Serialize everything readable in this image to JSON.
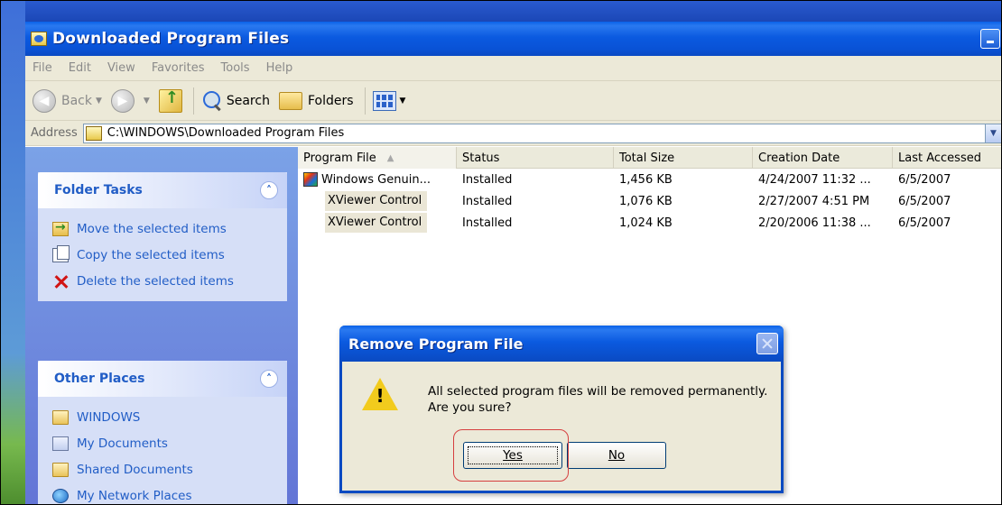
{
  "window": {
    "title": "Downloaded Program Files"
  },
  "menu": [
    "File",
    "Edit",
    "View",
    "Favorites",
    "Tools",
    "Help"
  ],
  "toolbar": {
    "back_label": "Back",
    "search_label": "Search",
    "folders_label": "Folders"
  },
  "address": {
    "label": "Address",
    "value": "C:\\WINDOWS\\Downloaded Program Files"
  },
  "folder_tasks": {
    "title": "Folder Tasks",
    "items": [
      {
        "label": "Move the selected items",
        "icon": "move-icon"
      },
      {
        "label": "Copy the selected items",
        "icon": "copy-icon"
      },
      {
        "label": "Delete the selected items",
        "icon": "delete-icon"
      }
    ]
  },
  "other_places": {
    "title": "Other Places",
    "items": [
      {
        "label": "WINDOWS",
        "icon": "folder-icon"
      },
      {
        "label": "My Documents",
        "icon": "docs-icon"
      },
      {
        "label": "Shared Documents",
        "icon": "folder-icon"
      },
      {
        "label": "My Network Places",
        "icon": "network-icon"
      }
    ]
  },
  "file_list": {
    "columns": [
      "Program File",
      "Status",
      "Total Size",
      "Creation Date",
      "Last Accessed"
    ],
    "rows": [
      {
        "name": "Windows Genuin...",
        "status": "Installed",
        "size": "1,456 KB",
        "created": "4/24/2007 11:32 ...",
        "accessed": "6/5/2007"
      },
      {
        "name": "XViewer Control",
        "status": "Installed",
        "size": "1,076 KB",
        "created": "2/27/2007 4:51 PM",
        "accessed": "6/5/2007"
      },
      {
        "name": "XViewer Control",
        "status": "Installed",
        "size": "1,024 KB",
        "created": "2/20/2006 11:38 ...",
        "accessed": "6/5/2007"
      }
    ]
  },
  "dialog": {
    "title": "Remove Program File",
    "message_line1": "All selected program files will be removed permanently.",
    "message_line2": "Are you sure?",
    "yes_label": "Yes",
    "no_label": "No"
  },
  "colors": {
    "title_bar": "#0a4ac2",
    "task_link": "#215dc6",
    "highlight_ring": "#d64040"
  }
}
